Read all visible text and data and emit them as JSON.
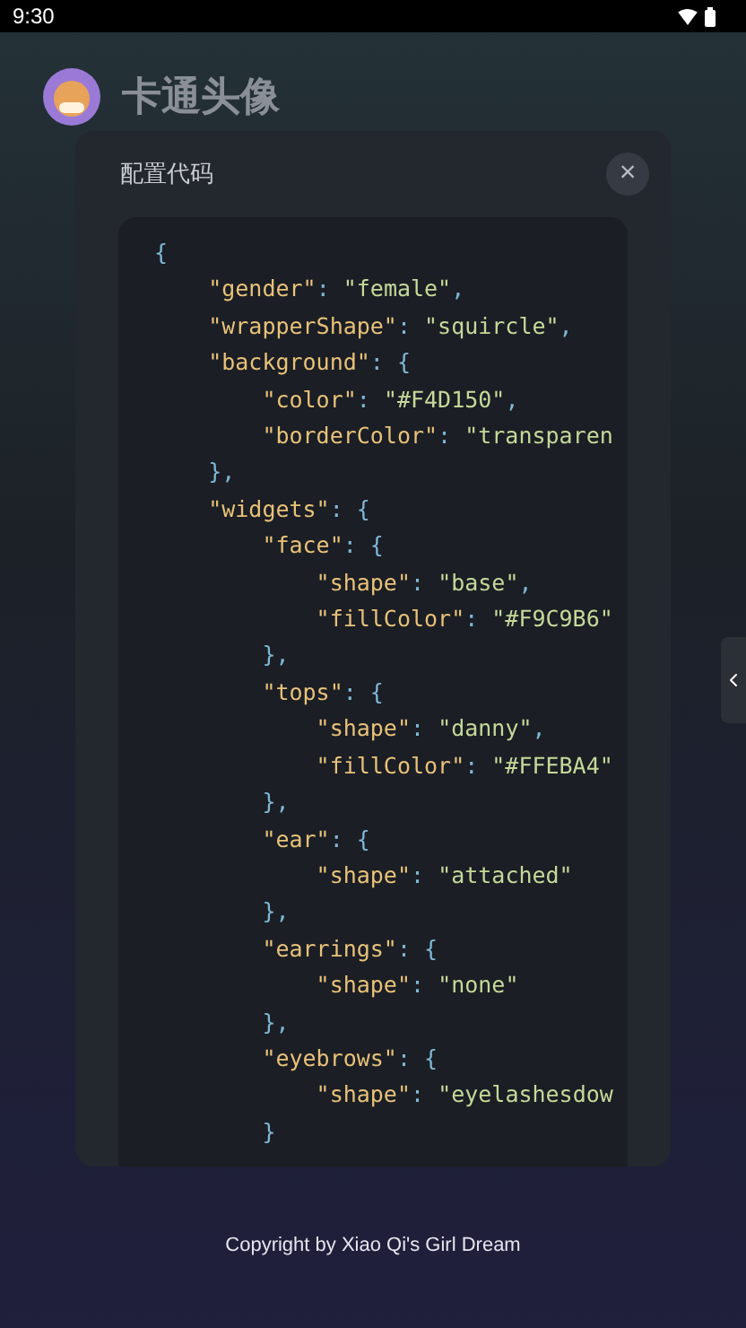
{
  "status_bar": {
    "time": "9:30"
  },
  "page": {
    "title": "卡通头像"
  },
  "dialog": {
    "title": "配置代码",
    "close": "×",
    "code_lines": [
      [
        {
          "kind": "punct",
          "text": "{"
        }
      ],
      [
        {
          "kind": "key",
          "text": "    \"gender\""
        },
        {
          "kind": "punct",
          "text": ": "
        },
        {
          "kind": "str",
          "text": "\"female\""
        },
        {
          "kind": "punct",
          "text": ","
        }
      ],
      [
        {
          "kind": "key",
          "text": "    \"wrapperShape\""
        },
        {
          "kind": "punct",
          "text": ": "
        },
        {
          "kind": "str",
          "text": "\"squircle\""
        },
        {
          "kind": "punct",
          "text": ","
        }
      ],
      [
        {
          "kind": "key",
          "text": "    \"background\""
        },
        {
          "kind": "punct",
          "text": ": {"
        }
      ],
      [
        {
          "kind": "key",
          "text": "        \"color\""
        },
        {
          "kind": "punct",
          "text": ": "
        },
        {
          "kind": "str",
          "text": "\"#F4D150\""
        },
        {
          "kind": "punct",
          "text": ","
        }
      ],
      [
        {
          "kind": "key",
          "text": "        \"borderColor\""
        },
        {
          "kind": "punct",
          "text": ": "
        },
        {
          "kind": "str",
          "text": "\"transparen"
        }
      ],
      [
        {
          "kind": "punct",
          "text": "    },"
        }
      ],
      [
        {
          "kind": "key",
          "text": "    \"widgets\""
        },
        {
          "kind": "punct",
          "text": ": {"
        }
      ],
      [
        {
          "kind": "key",
          "text": "        \"face\""
        },
        {
          "kind": "punct",
          "text": ": {"
        }
      ],
      [
        {
          "kind": "key",
          "text": "            \"shape\""
        },
        {
          "kind": "punct",
          "text": ": "
        },
        {
          "kind": "str",
          "text": "\"base\""
        },
        {
          "kind": "punct",
          "text": ","
        }
      ],
      [
        {
          "kind": "key",
          "text": "            \"fillColor\""
        },
        {
          "kind": "punct",
          "text": ": "
        },
        {
          "kind": "str",
          "text": "\"#F9C9B6\""
        }
      ],
      [
        {
          "kind": "punct",
          "text": "        },"
        }
      ],
      [
        {
          "kind": "key",
          "text": "        \"tops\""
        },
        {
          "kind": "punct",
          "text": ": {"
        }
      ],
      [
        {
          "kind": "key",
          "text": "            \"shape\""
        },
        {
          "kind": "punct",
          "text": ": "
        },
        {
          "kind": "str",
          "text": "\"danny\""
        },
        {
          "kind": "punct",
          "text": ","
        }
      ],
      [
        {
          "kind": "key",
          "text": "            \"fillColor\""
        },
        {
          "kind": "punct",
          "text": ": "
        },
        {
          "kind": "str",
          "text": "\"#FFEBA4\""
        }
      ],
      [
        {
          "kind": "punct",
          "text": "        },"
        }
      ],
      [
        {
          "kind": "key",
          "text": "        \"ear\""
        },
        {
          "kind": "punct",
          "text": ": {"
        }
      ],
      [
        {
          "kind": "key",
          "text": "            \"shape\""
        },
        {
          "kind": "punct",
          "text": ": "
        },
        {
          "kind": "str",
          "text": "\"attached\""
        }
      ],
      [
        {
          "kind": "punct",
          "text": "        },"
        }
      ],
      [
        {
          "kind": "key",
          "text": "        \"earrings\""
        },
        {
          "kind": "punct",
          "text": ": {"
        }
      ],
      [
        {
          "kind": "key",
          "text": "            \"shape\""
        },
        {
          "kind": "punct",
          "text": ": "
        },
        {
          "kind": "str",
          "text": "\"none\""
        }
      ],
      [
        {
          "kind": "punct",
          "text": "        },"
        }
      ],
      [
        {
          "kind": "key",
          "text": "        \"eyebrows\""
        },
        {
          "kind": "punct",
          "text": ": {"
        }
      ],
      [
        {
          "kind": "key",
          "text": "            \"shape\""
        },
        {
          "kind": "punct",
          "text": ": "
        },
        {
          "kind": "str",
          "text": "\"eyelashesdow"
        }
      ],
      [
        {
          "kind": "punct",
          "text": "        }"
        }
      ]
    ]
  },
  "footer": {
    "copyright": "Copyright by Xiao Qi's Girl Dream"
  }
}
